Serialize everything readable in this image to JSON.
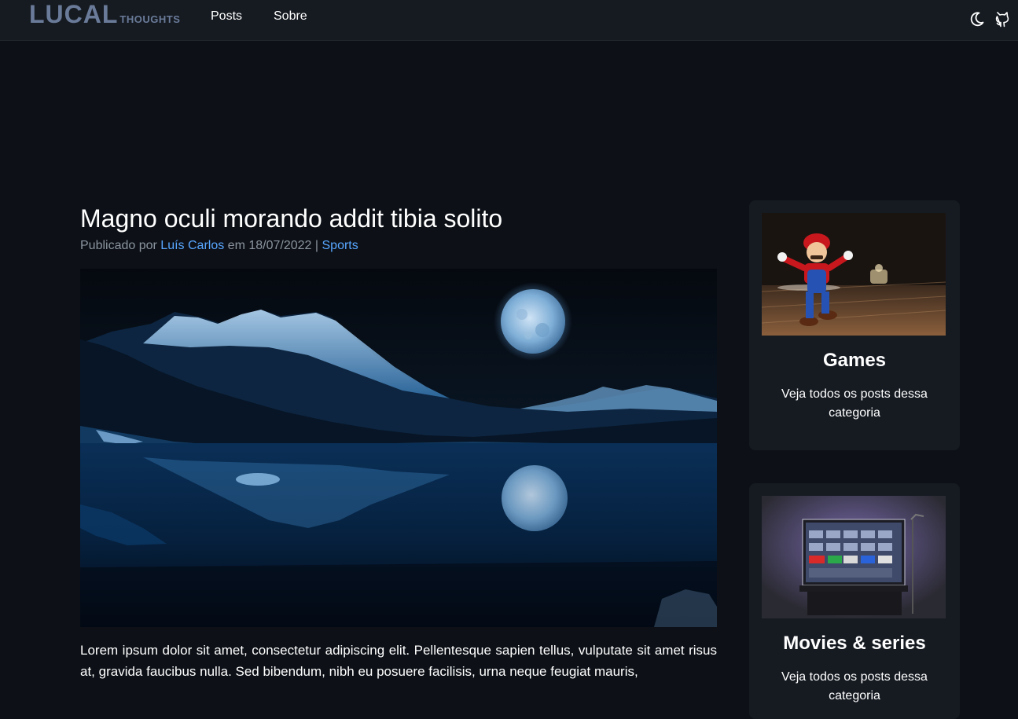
{
  "brand": {
    "name": "LUCAL",
    "tagline": "THOUGHTS"
  },
  "nav": {
    "items": [
      {
        "label": "Posts"
      },
      {
        "label": "Sobre"
      }
    ]
  },
  "icons": {
    "theme_toggle": "moon-icon",
    "repo": "github-icon"
  },
  "post": {
    "title": "Magno oculi morando addit tibia solito",
    "meta": {
      "prefix": "Publicado por",
      "author": "Luís Carlos",
      "date_prefix": "em",
      "date": "18/07/2022",
      "separator": "|",
      "category": "Sports"
    },
    "body": "Lorem ipsum dolor sit amet, consectetur adipiscing elit. Pellentesque sapien tellus, vulputate sit amet risus at, gravida faucibus nulla. Sed bibendum, nibh eu posuere facilisis, urna neque feugiat mauris,"
  },
  "sidebar": {
    "cards": [
      {
        "title": "Games",
        "description": "Veja todos os posts dessa categoria"
      },
      {
        "title": "Movies & series",
        "description": "Veja todos os posts dessa categoria"
      }
    ]
  },
  "colors": {
    "page_bg": "#0d1117",
    "navbar_bg": "#161b22",
    "card_bg": "#161b22",
    "link": "#58a6ff",
    "brand": "#6a7b99",
    "muted_text": "#8b949e"
  }
}
